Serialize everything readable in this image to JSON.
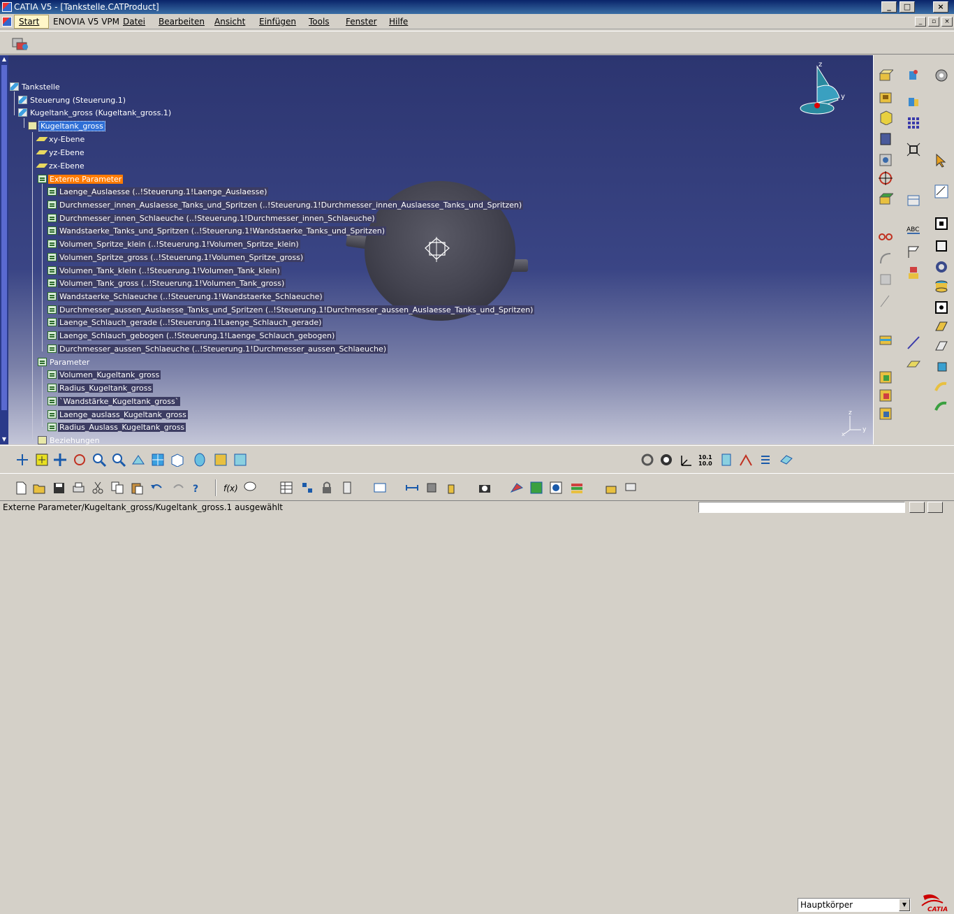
{
  "window": {
    "title": "CATIA V5 - [Tankstelle.CATProduct]"
  },
  "menu": {
    "items": [
      "Start",
      "ENOVIA V5 VPM",
      "Datei",
      "Bearbeiten",
      "Ansicht",
      "Einfügen",
      "Tools",
      "Fenster",
      "Hilfe"
    ]
  },
  "tree": {
    "root": "Tankstelle",
    "steuerung": "Steuerung (Steuerung.1)",
    "kugeltank_inst": "Kugeltank_gross (Kugeltank_gross.1)",
    "kugeltank_part": "Kugeltank_gross",
    "planes": [
      "xy-Ebene",
      "yz-Ebene",
      "zx-Ebene"
    ],
    "externe_parameter": "Externe Parameter",
    "external_params": [
      "Laenge_Auslaesse (..!Steuerung.1!Laenge_Auslaesse)",
      "Durchmesser_innen_Auslaesse_Tanks_und_Spritzen (..!Steuerung.1!Durchmesser_innen_Auslaesse_Tanks_und_Spritzen)",
      "Durchmesser_innen_Schlaeuche (..!Steuerung.1!Durchmesser_innen_Schlaeuche)",
      "Wandstaerke_Tanks_und_Spritzen (..!Steuerung.1!Wandstaerke_Tanks_und_Spritzen)",
      "Volumen_Spritze_klein (..!Steuerung.1!Volumen_Spritze_klein)",
      "Volumen_Spritze_gross (..!Steuerung.1!Volumen_Spritze_gross)",
      "Volumen_Tank_klein (..!Steuerung.1!Volumen_Tank_klein)",
      "Volumen_Tank_gross (..!Steuerung.1!Volumen_Tank_gross)",
      "Wandstaerke_Schlaeuche (..!Steuerung.1!Wandstaerke_Schlaeuche)",
      "Durchmesser_aussen_Auslaesse_Tanks_und_Spritzen (..!Steuerung.1!Durchmesser_aussen_Auslaesse_Tanks_und_Spritzen)",
      "Laenge_Schlauch_gerade (..!Steuerung.1!Laenge_Schlauch_gerade)",
      "Laenge_Schlauch_gebogen (..!Steuerung.1!Laenge_Schlauch_gebogen)",
      "Durchmesser_aussen_Schlaeuche (..!Steuerung.1!Durchmesser_aussen_Schlaeuche)"
    ],
    "parameter": "Parameter",
    "params": [
      "Volumen_Kugeltank_gross",
      "Radius_Kugeltank_gross",
      "`Wandstärke_Kugeltank_gross`",
      "Laenge_auslass_Kugeltank_gross",
      "Radius_Auslass_Kugeltank_gross"
    ],
    "beziehungen": "Beziehungen"
  },
  "compass": {
    "z": "z",
    "y": "y",
    "x": "x"
  },
  "body_select": {
    "value": "Hauptkörper"
  },
  "logo": {
    "text": "CATIA"
  },
  "status": {
    "text": "Externe Parameter/Kugeltank_gross/Kugeltank_gross.1 ausgewählt"
  },
  "colors": {
    "viewport_top": "#2c3570",
    "viewport_bottom": "#c4c6d8",
    "selection": "#2f6fd6",
    "highlight": "#ff7b00"
  }
}
